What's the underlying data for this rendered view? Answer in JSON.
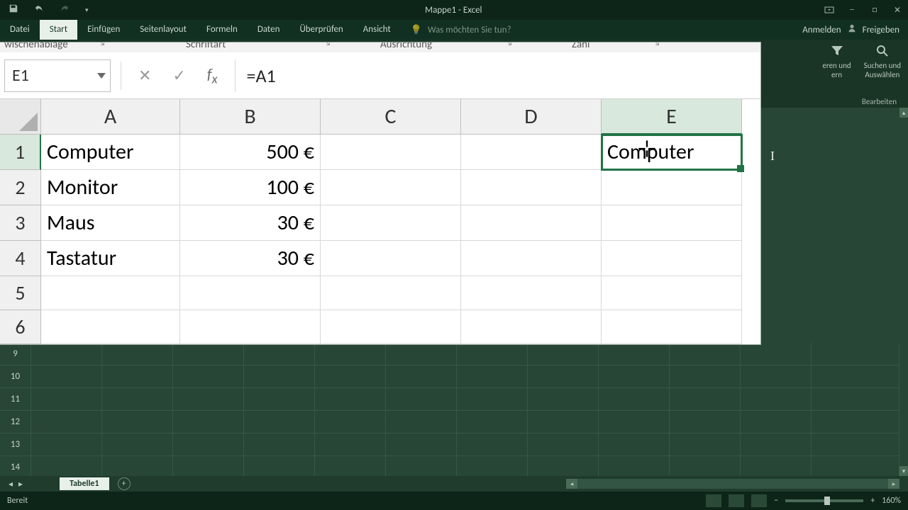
{
  "app": {
    "title": "Mappe1 - Excel"
  },
  "ribbon": {
    "tabs": {
      "file": "Datei",
      "home": "Start",
      "insert": "Einfügen",
      "pagelayout": "Seitenlayout",
      "formulas": "Formeln",
      "data": "Daten",
      "review": "Überprüfen",
      "view": "Ansicht"
    },
    "tell_me": "Was möchten Sie tun?",
    "signin": "Anmelden",
    "share": "Freigeben",
    "groups": {
      "clipboard": "wischenablage",
      "font": "Schriftart",
      "alignment": "Ausrichtung",
      "number": "Zahl"
    },
    "right_pane": {
      "sortfilter": "eren und\nern",
      "findselect": "Suchen und\nAuswählen",
      "editing": "Bearbeiten"
    }
  },
  "formula_bar": {
    "name_box": "E1",
    "formula": "=A1"
  },
  "columns": [
    "A",
    "B",
    "C",
    "D",
    "E"
  ],
  "rows_visible": [
    "1",
    "2",
    "3",
    "4",
    "5",
    "6"
  ],
  "selected_cell": "E1",
  "cells": {
    "A1": "Computer",
    "B1": "500 €",
    "A2": "Monitor",
    "B2": "100 €",
    "A3": "Maus",
    "B3": "30 €",
    "A4": "Tastatur",
    "B4": "30 €",
    "E1": "Computer"
  },
  "dim_rows": [
    "9",
    "10",
    "11",
    "12",
    "13",
    "14"
  ],
  "sheet": {
    "tab_name": "Tabelle1"
  },
  "status": {
    "ready": "Bereit",
    "zoom": "160%"
  }
}
